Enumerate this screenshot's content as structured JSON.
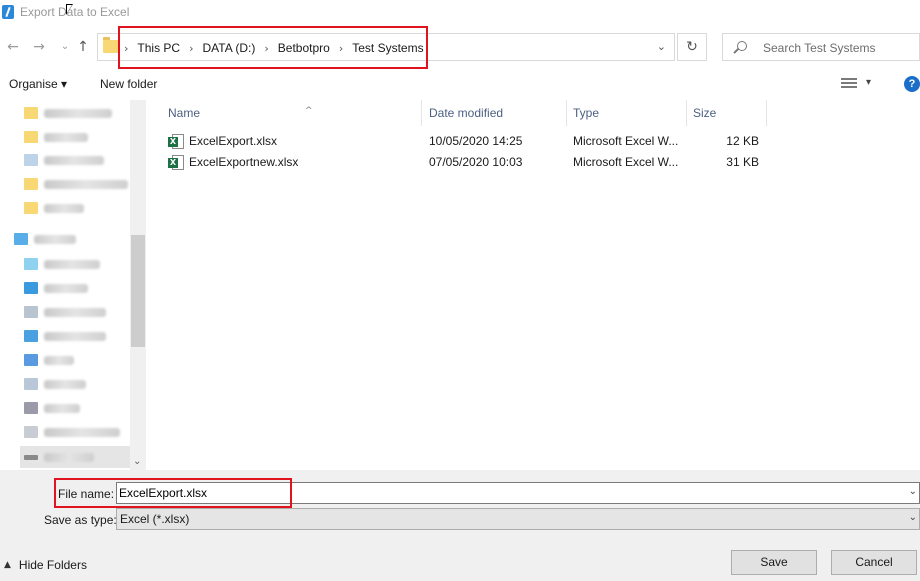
{
  "window": {
    "title": "Export Data to Excel"
  },
  "nav": {
    "back_glyph": "←",
    "forward_glyph": "→",
    "up_glyph": "↑",
    "refresh_glyph": "↻",
    "dropdown_glyph": "⌄",
    "breadcrumbs": [
      "This PC",
      "DATA (D:)",
      "Betbotpro",
      "Test Systems"
    ],
    "separator": "›",
    "search_placeholder": "Search Test Systems"
  },
  "toolbar": {
    "organise_label": "Organise ▾",
    "new_folder_label": "New folder",
    "view_dropdown": "▾",
    "help_label": "?"
  },
  "columns": {
    "name": "Name",
    "date": "Date modified",
    "type": "Type",
    "size": "Size"
  },
  "files": [
    {
      "name": "ExcelExport.xlsx",
      "date": "10/05/2020 14:25",
      "type": "Microsoft Excel W...",
      "size": "12 KB"
    },
    {
      "name": "ExcelExportnew.xlsx",
      "date": "07/05/2020 10:03",
      "type": "Microsoft Excel W...",
      "size": "31 KB"
    }
  ],
  "form": {
    "file_name_label": "File name:",
    "file_name_value": "ExcelExport.xlsx",
    "save_as_type_label": "Save as type:",
    "save_as_type_value": "Excel (*.xlsx)"
  },
  "footer": {
    "hide_folders_label": "Hide Folders",
    "hide_caret": "▲",
    "save_label": "Save",
    "cancel_label": "Cancel"
  },
  "colors": {
    "highlight": "#e0141e",
    "excel_green": "#1d7145",
    "folder_yellow": "#f8d775",
    "help_blue": "#1c6fc9"
  }
}
